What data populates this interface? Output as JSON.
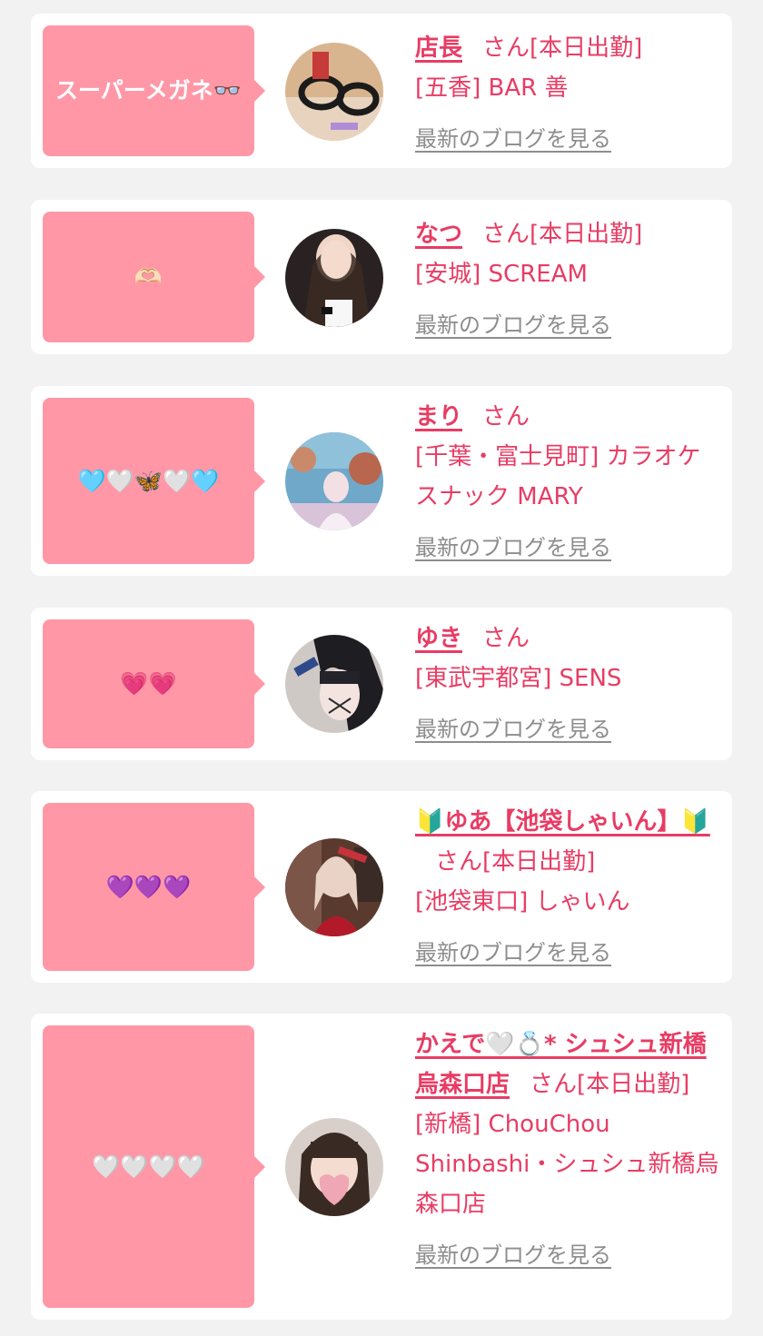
{
  "colors": {
    "page_background": "#f2f2f2",
    "card_background": "#ffffff",
    "bubble": "#ff97a7",
    "accent_text": "#e83c64",
    "link_gray": "#8d8d8d"
  },
  "common": {
    "honorific": "さん",
    "blog_link_label": "最新のブログを見る"
  },
  "entries": [
    {
      "comment": "スーパーメガネ👓",
      "name": "店長",
      "status": "[本日出勤]",
      "shop": "[五香] BAR 善",
      "avatar_icon": "glasses-photo-avatar"
    },
    {
      "comment": "🫶🏻",
      "name": "なつ",
      "status": "[本日出勤]",
      "shop": "[安城] SCREAM",
      "avatar_icon": "woman-photo-avatar"
    },
    {
      "comment": "🩵🤍🦋🤍🩵",
      "name": "まり",
      "status": "",
      "shop": "[千葉・富士見町] カラオケスナック MARY",
      "avatar_icon": "aquarium-photo-avatar"
    },
    {
      "comment": "💗💗",
      "name": "ゆき",
      "status": "",
      "shop": "[東武宇都宮] SENS",
      "avatar_icon": "woman-photo-avatar"
    },
    {
      "comment": "💜💜💜",
      "name": "🔰ゆあ【池袋しゃいん】🔰",
      "status": "[本日出勤]",
      "shop": "[池袋東口] しゃいん",
      "avatar_icon": "woman-photo-avatar"
    },
    {
      "comment": "🤍🤍🤍🤍",
      "name": "かえで🤍💍* シュシュ新橋烏森口店",
      "status": "[本日出勤]",
      "shop": "[新橋] ChouChou Shinbashi・シュシュ新橋烏森口店",
      "avatar_icon": "masked-face-photo-avatar"
    }
  ]
}
